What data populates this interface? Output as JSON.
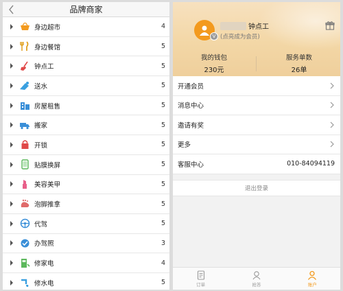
{
  "left": {
    "title": "品牌商家",
    "items": [
      {
        "label": "身边超市",
        "count": "4",
        "icon": "basket-icon"
      },
      {
        "label": "身边餐馆",
        "count": "5",
        "icon": "fork-knife-icon"
      },
      {
        "label": "钟点工",
        "count": "5",
        "icon": "cleaning-icon"
      },
      {
        "label": "送水",
        "count": "5",
        "icon": "water-delivery-icon"
      },
      {
        "label": "房屋租售",
        "count": "5",
        "icon": "building-icon"
      },
      {
        "label": "搬家",
        "count": "5",
        "icon": "truck-icon"
      },
      {
        "label": "开锁",
        "count": "5",
        "icon": "lock-icon"
      },
      {
        "label": "贴膜换屏",
        "count": "5",
        "icon": "phone-icon"
      },
      {
        "label": "美容美甲",
        "count": "5",
        "icon": "lipstick-icon"
      },
      {
        "label": "泡脚推拿",
        "count": "5",
        "icon": "foot-icon"
      },
      {
        "label": "代驾",
        "count": "5",
        "icon": "steering-wheel-icon"
      },
      {
        "label": "办驾照",
        "count": "3",
        "icon": "license-icon"
      },
      {
        "label": "修家电",
        "count": "4",
        "icon": "appliance-icon"
      },
      {
        "label": "修水电",
        "count": "5",
        "icon": "plumbing-icon"
      }
    ]
  },
  "right": {
    "profile": {
      "username": "钟点工",
      "member_hint": "(点亮成为会员)",
      "badge": "V"
    },
    "stats": {
      "wallet_label": "我的钱包",
      "wallet_value": "230元",
      "orders_label": "服务单数",
      "orders_value": "26单"
    },
    "menu": [
      {
        "label": "开通会员"
      },
      {
        "label": "消息中心"
      },
      {
        "label": "邀请有奖"
      },
      {
        "label": "更多"
      }
    ],
    "service": {
      "label": "客服中心",
      "value": "010-84094119"
    },
    "logout_label": "退出登录",
    "tabs": [
      {
        "label": "订单",
        "icon": "order-icon"
      },
      {
        "label": "抢答",
        "icon": "grab-icon"
      },
      {
        "label": "账户",
        "icon": "account-icon"
      }
    ],
    "colors": {
      "accent": "#f39a1e",
      "header_bg": "#f3d7a6"
    }
  }
}
